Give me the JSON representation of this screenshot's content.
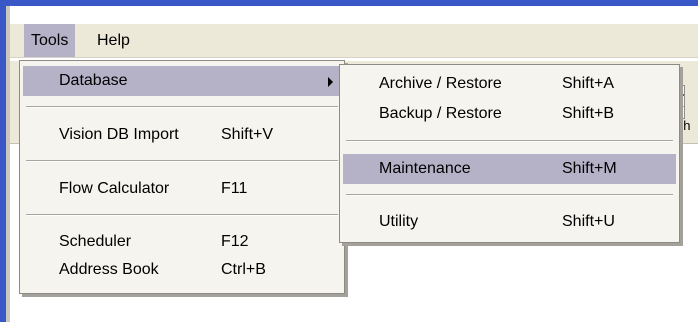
{
  "menubar": {
    "tools_label": "Tools",
    "help_label": "Help"
  },
  "background": {
    "partial_text": "ph"
  },
  "tools_menu": {
    "database_label": "Database",
    "vision_import_label": "Vision DB Import",
    "vision_import_shortcut": "Shift+V",
    "flow_calculator_label": "Flow Calculator",
    "flow_calculator_shortcut": "F11",
    "scheduler_label": "Scheduler",
    "scheduler_shortcut": "F12",
    "address_book_label": "Address Book",
    "address_book_shortcut": "Ctrl+B"
  },
  "database_menu": {
    "archive_restore_label": "Archive / Restore",
    "archive_restore_shortcut": "Shift+A",
    "backup_restore_label": "Backup / Restore",
    "backup_restore_shortcut": "Shift+B",
    "maintenance_label": "Maintenance",
    "maintenance_shortcut": "Shift+M",
    "utility_label": "Utility",
    "utility_shortcut": "Shift+U"
  },
  "colors": {
    "frame": "#3a57c8",
    "menubar": "#ece9d8",
    "menu_background": "#f5f4ee",
    "highlight": "#b5b1c7"
  }
}
